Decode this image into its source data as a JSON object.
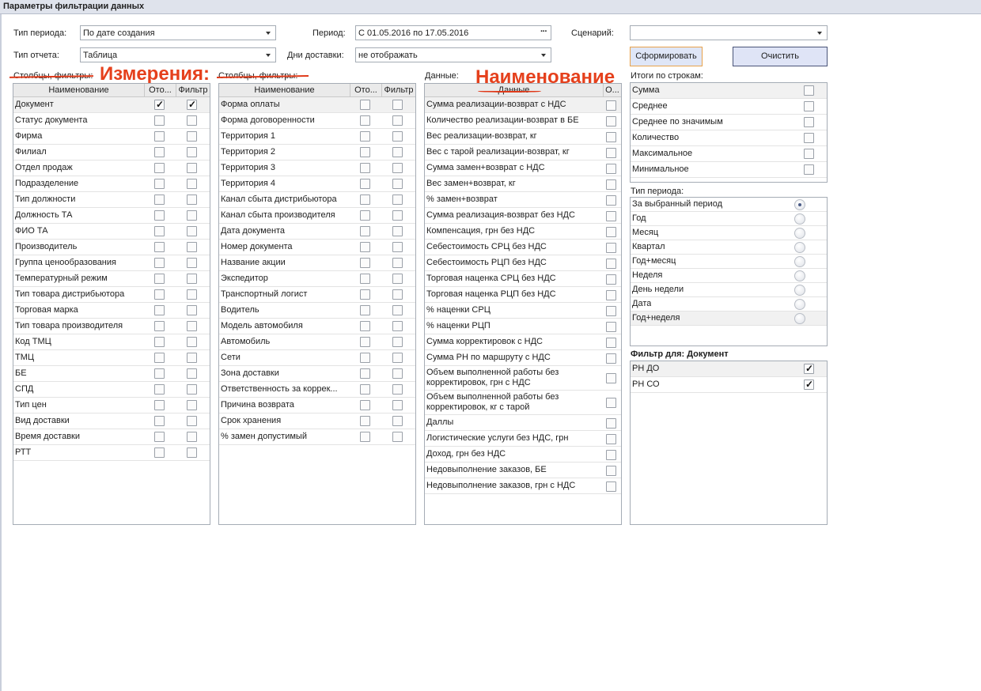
{
  "window": {
    "title": "Параметры фильтрации данных"
  },
  "form": {
    "period_type_label": "Тип периода:",
    "period_type_value": "По дате создания",
    "report_type_label": "Тип отчета:",
    "report_type_value": "Таблица",
    "period_label": "Период:",
    "period_value": "С 01.05.2016 по 17.05.2016",
    "delivery_days_label": "Дни доставки:",
    "delivery_days_value": "не отображать",
    "scenario_label": "Сценарий:",
    "scenario_value": "",
    "build_button": "Сформировать",
    "clear_button": "Очистить"
  },
  "annotations": {
    "measures": "Измерения:",
    "naming": "Наименование"
  },
  "dims1": {
    "section_label": "Столбцы, фильтры:",
    "col_name": "Наименование",
    "col_show": "Ото...",
    "col_filter": "Фильтр",
    "rows": [
      {
        "name": "Документ",
        "show": true,
        "filter": true
      },
      {
        "name": "Статус документа",
        "show": false,
        "filter": false
      },
      {
        "name": "Фирма",
        "show": false,
        "filter": false
      },
      {
        "name": "Филиал",
        "show": false,
        "filter": false
      },
      {
        "name": "Отдел продаж",
        "show": false,
        "filter": false
      },
      {
        "name": "Подразделение",
        "show": false,
        "filter": false
      },
      {
        "name": "Тип должности",
        "show": false,
        "filter": false
      },
      {
        "name": "Должность ТА",
        "show": false,
        "filter": false
      },
      {
        "name": "ФИО ТА",
        "show": false,
        "filter": false
      },
      {
        "name": "Производитель",
        "show": false,
        "filter": false
      },
      {
        "name": "Группа ценообразования",
        "show": false,
        "filter": false
      },
      {
        "name": "Температурный режим",
        "show": false,
        "filter": false
      },
      {
        "name": "Тип товара дистрибьютора",
        "show": false,
        "filter": false
      },
      {
        "name": "Торговая марка",
        "show": false,
        "filter": false
      },
      {
        "name": "Тип товара производителя",
        "show": false,
        "filter": false
      },
      {
        "name": "Код ТМЦ",
        "show": false,
        "filter": false
      },
      {
        "name": "ТМЦ",
        "show": false,
        "filter": false
      },
      {
        "name": "БЕ",
        "show": false,
        "filter": false
      },
      {
        "name": "СПД",
        "show": false,
        "filter": false
      },
      {
        "name": "Тип цен",
        "show": false,
        "filter": false
      },
      {
        "name": "Вид доставки",
        "show": false,
        "filter": false
      },
      {
        "name": "Время доставки",
        "show": false,
        "filter": false
      },
      {
        "name": "РТТ",
        "show": false,
        "filter": false
      }
    ]
  },
  "dims2": {
    "section_label": "Столбцы, фильтры:",
    "col_name": "Наименование",
    "col_show": "Ото...",
    "col_filter": "Фильтр",
    "rows": [
      {
        "name": "Форма оплаты",
        "show": false,
        "filter": false
      },
      {
        "name": "Форма договоренности",
        "show": false,
        "filter": false
      },
      {
        "name": "Территория 1",
        "show": false,
        "filter": false
      },
      {
        "name": "Территория 2",
        "show": false,
        "filter": false
      },
      {
        "name": "Территория 3",
        "show": false,
        "filter": false
      },
      {
        "name": "Территория 4",
        "show": false,
        "filter": false
      },
      {
        "name": "Канал сбыта дистрибьютора",
        "show": false,
        "filter": false
      },
      {
        "name": "Канал сбыта производителя",
        "show": false,
        "filter": false
      },
      {
        "name": "Дата документа",
        "show": false,
        "filter": false
      },
      {
        "name": "Номер документа",
        "show": false,
        "filter": false
      },
      {
        "name": "Название акции",
        "show": false,
        "filter": false
      },
      {
        "name": "Экспедитор",
        "show": false,
        "filter": false
      },
      {
        "name": "Транспортный логист",
        "show": false,
        "filter": false
      },
      {
        "name": "Водитель",
        "show": false,
        "filter": false
      },
      {
        "name": "Модель автомобиля",
        "show": false,
        "filter": false
      },
      {
        "name": "Автомобиль",
        "show": false,
        "filter": false
      },
      {
        "name": "Сети",
        "show": false,
        "filter": false
      },
      {
        "name": "Зона доставки",
        "show": false,
        "filter": false
      },
      {
        "name": "Ответственность за коррек...",
        "show": false,
        "filter": false
      },
      {
        "name": "Причина возврата",
        "show": false,
        "filter": false
      },
      {
        "name": "Срок хранения",
        "show": false,
        "filter": false
      },
      {
        "name": "% замен допустимый",
        "show": false,
        "filter": false
      }
    ]
  },
  "measures": {
    "section_label": "Данные:",
    "col_name": "Данные",
    "col_show": "О...",
    "rows": [
      {
        "name": "Сумма реализации-возврат с НДС",
        "checked": false
      },
      {
        "name": "Количество реализации-возврат в БЕ",
        "checked": false
      },
      {
        "name": "Вес реализации-возврат, кг",
        "checked": false
      },
      {
        "name": "Вес с тарой реализации-возврат, кг",
        "checked": false
      },
      {
        "name": "Сумма замен+возврат с НДС",
        "checked": false
      },
      {
        "name": "Вес замен+возврат, кг",
        "checked": false
      },
      {
        "name": "% замен+возврат",
        "checked": false
      },
      {
        "name": "Сумма реализация-возврат без НДС",
        "checked": false
      },
      {
        "name": "Компенсация, грн без НДС",
        "checked": false
      },
      {
        "name": "Себестоимость СРЦ без НДС",
        "checked": false
      },
      {
        "name": "Себестоимость РЦП без НДС",
        "checked": false
      },
      {
        "name": "Торговая наценка СРЦ без НДС",
        "checked": false
      },
      {
        "name": "Торговая наценка РЦП без НДС",
        "checked": false
      },
      {
        "name": "% наценки СРЦ",
        "checked": false
      },
      {
        "name": "% наценки РЦП",
        "checked": false
      },
      {
        "name": "Сумма корректировок с НДС",
        "checked": false
      },
      {
        "name": "Сумма РН по маршруту с НДС",
        "checked": false
      },
      {
        "name": "Объем выполненной работы без корректировок, грн с НДС",
        "checked": false,
        "multiline": true
      },
      {
        "name": "Объем выполненной работы без корректировок, кг  с тарой",
        "checked": false,
        "multiline": true
      },
      {
        "name": "Даллы",
        "checked": false
      },
      {
        "name": "Логистические услуги без НДС, грн",
        "checked": false
      },
      {
        "name": "Доход, грн без НДС",
        "checked": false
      },
      {
        "name": "Недовыполнение заказов, БЕ",
        "checked": false
      },
      {
        "name": "Недовыполнение заказов, грн с НДС",
        "checked": false
      }
    ]
  },
  "totals": {
    "section_label": "Итоги по строкам:",
    "rows": [
      {
        "name": "Сумма",
        "checked": false
      },
      {
        "name": "Среднее",
        "checked": false
      },
      {
        "name": "Среднее по значимым",
        "checked": false
      },
      {
        "name": "Количество",
        "checked": false
      },
      {
        "name": "Максимальное",
        "checked": false
      },
      {
        "name": "Минимальное",
        "checked": false
      }
    ]
  },
  "period_group": {
    "section_label": "Тип периода:",
    "rows": [
      {
        "name": "За выбранный период",
        "selected": true
      },
      {
        "name": "Год",
        "selected": false
      },
      {
        "name": "Месяц",
        "selected": false
      },
      {
        "name": "Квартал",
        "selected": false
      },
      {
        "name": "Год+месяц",
        "selected": false
      },
      {
        "name": "Неделя",
        "selected": false
      },
      {
        "name": "День недели",
        "selected": false
      },
      {
        "name": "Дата",
        "selected": false
      },
      {
        "name": "Год+неделя",
        "selected": false
      }
    ]
  },
  "doc_filter": {
    "section_label": "Фильтр для: Документ",
    "rows": [
      {
        "name": "РН ДО",
        "checked": true
      },
      {
        "name": "РН СО",
        "checked": true
      }
    ]
  }
}
